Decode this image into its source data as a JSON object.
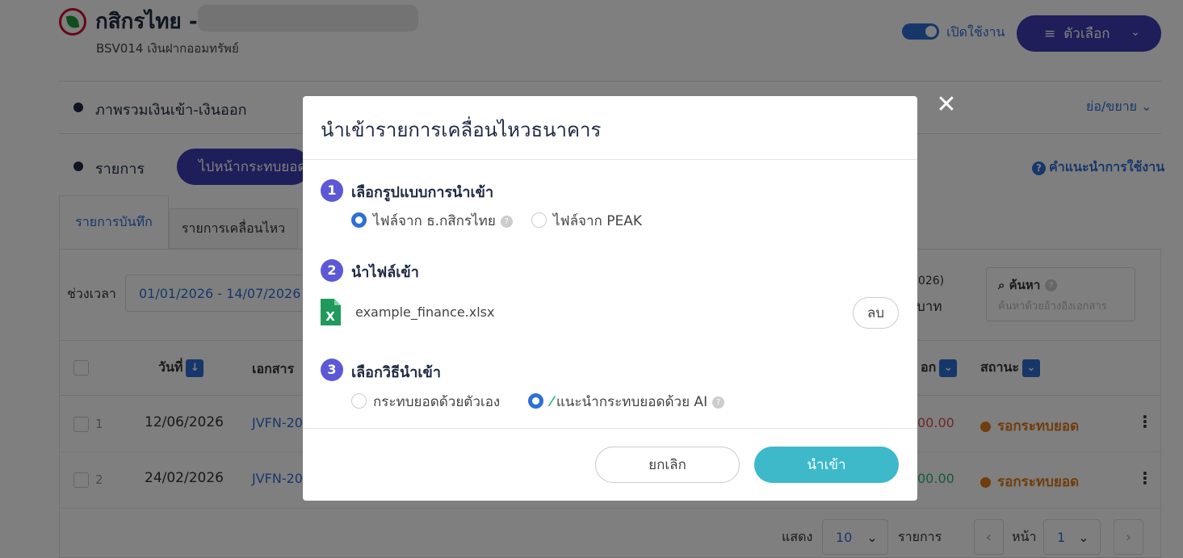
{
  "header": {
    "bank_name": "กสิกรไทย -",
    "account_subtitle": "BSV014 เงินฝากออมทรัพย์",
    "toggle_label": "เปิดใช้งาน",
    "options_label": "ตัวเลือก"
  },
  "summary_section": {
    "title": "ภาพรวมเงินเข้า-เงินออก",
    "collapse_label": "ย่อ/ขยาย"
  },
  "list_section": {
    "title": "รายการ",
    "goto_button": "ไปหน้ากระทบยอด",
    "help_label": "คำแนะนำการใช้งาน",
    "tabs": [
      {
        "label": "รายการบันทึก",
        "active": true
      },
      {
        "label": "รายการเคลื่อนไหว",
        "active": false
      }
    ],
    "period_label": "ช่วงเวลา",
    "period_value": "01/01/2026 - 14/07/2026",
    "balance_year_fragment": "2026)",
    "balance_unit": "บาท",
    "search_title": "ค้นหา",
    "search_placeholder": "ค้นหาด้วยอ้างอิงเอกสาร"
  },
  "table": {
    "headers": {
      "date": "วันที่",
      "document": "เอกสาร",
      "amount_fragment": "อก",
      "status": "สถานะ"
    },
    "rows": [
      {
        "index": "1",
        "date": "12/06/2026",
        "doc": "JVFN-20",
        "amount": "00.00",
        "amount_color": "#d9534f",
        "status": "รอกระทบยอด"
      },
      {
        "index": "2",
        "date": "24/02/2026",
        "doc": "JVFN-20",
        "amount": "00.00",
        "amount_color": "#2bb673",
        "status": "รอกระทบยอด"
      }
    ]
  },
  "pagination": {
    "show_label": "แสดง",
    "page_size": "10",
    "items_label": "รายการ",
    "page_label": "หน้า",
    "page_value": "1"
  },
  "modal": {
    "title": "นำเข้ารายการเคลื่อนไหวธนาคาร",
    "step1": {
      "number": "1",
      "title": "เลือกรูปแบบการนำเข้า",
      "options": [
        {
          "label": "ไฟล์จาก ธ.กสิกรไทย",
          "selected": true
        },
        {
          "label": "ไฟล์จาก PEAK",
          "selected": false
        }
      ]
    },
    "step2": {
      "number": "2",
      "title": "นำไฟล์เข้า",
      "file_name": "example_finance.xlsx",
      "delete_label": "ลบ"
    },
    "step3": {
      "number": "3",
      "title": "เลือกวิธีนำเข้า",
      "options": [
        {
          "label": "กระทบยอดด้วยตัวเอง",
          "selected": false
        },
        {
          "label": "แนะนำกระทบยอดด้วย AI",
          "selected": true
        }
      ]
    },
    "cancel_label": "ยกเลิก",
    "import_label": "นำเข้า"
  },
  "colors": {
    "primary_purple": "#3d3db5",
    "link_blue": "#2f6fd6",
    "import_teal": "#3db9c9",
    "status_orange": "#e07b1a"
  }
}
